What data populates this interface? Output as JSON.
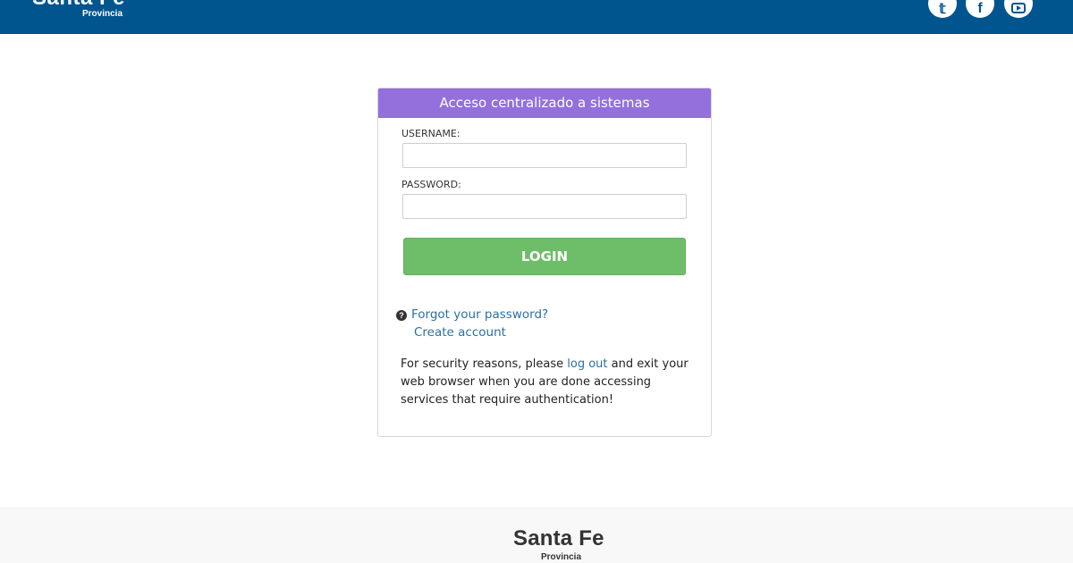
{
  "header": {
    "logo_main": "Santa Fe",
    "logo_sub": "Provincia",
    "social": {
      "twitter_icon": "twitter-icon",
      "facebook_icon": "facebook-icon",
      "youtube_icon": "youtube-icon",
      "twitter_glyph": "𝕥",
      "facebook_glyph": "f"
    }
  },
  "login_card": {
    "title": "Acceso centralizado a sistemas",
    "username_label": "USERNAME:",
    "password_label": "PASSWORD:",
    "username_value": "",
    "password_value": "",
    "login_button": "LOGIN",
    "forgot_password": "Forgot your password?",
    "create_account": "Create account",
    "help_icon_glyph": "?",
    "security_text_before": "For security reasons, please ",
    "security_link": "log out",
    "security_text_after": " and exit your web browser when you are done accessing services that require authentication!"
  },
  "footer": {
    "logo_main": "Santa Fe",
    "logo_sub": "Provincia"
  },
  "colors": {
    "header_blue": "#00558f",
    "card_header_purple": "#9370db",
    "login_green": "#6dbd69",
    "link_blue": "#2d6fa3"
  }
}
